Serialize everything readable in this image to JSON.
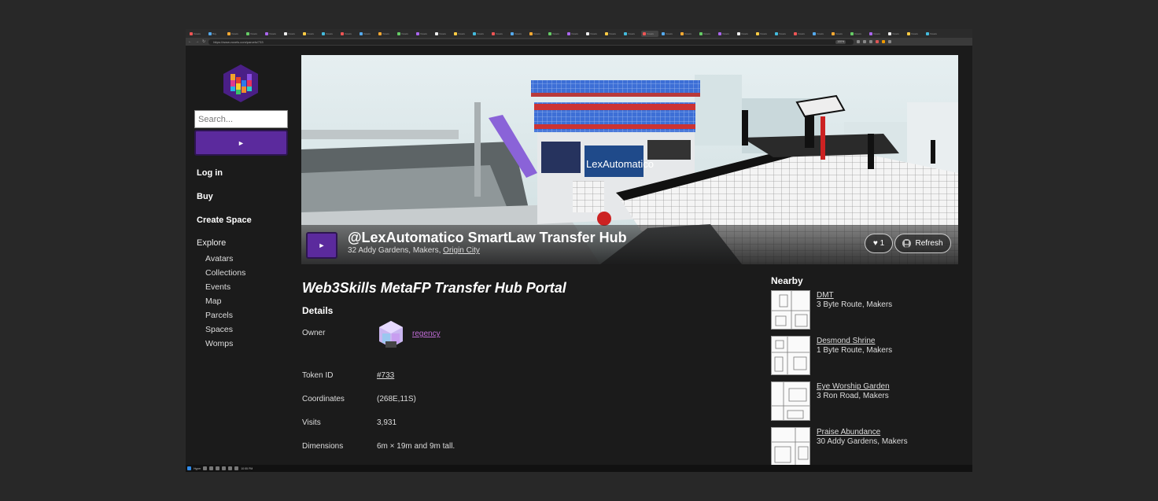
{
  "browser": {
    "tabs": [
      "Voxels",
      "Buy",
      "Voxels",
      "Voxels",
      "Voxels",
      "Voxels",
      "Voxels",
      "Voxels",
      "Voxels",
      "Voxels",
      "Voxels",
      "Voxels",
      "Voxels",
      "Voxels",
      "Voxels",
      "Voxels",
      "Voxels",
      "Voxels",
      "Voxels",
      "Voxels",
      "Voxels",
      "Voxels",
      "Voxels",
      "Voxels",
      "Voxels",
      "Voxels",
      "Voxels",
      "Voxels",
      "Voxels",
      "Voxels",
      "Voxels",
      "Voxels",
      "Voxels",
      "Voxels",
      "Voxels",
      "Voxels",
      "Voxels",
      "Voxels",
      "Voxels",
      "Voxels"
    ],
    "url": "https://www.voxels.com/parcels/733",
    "zoom": "100%"
  },
  "sidebar": {
    "search_placeholder": "Search...",
    "go_label": "►",
    "login": "Log in",
    "buy": "Buy",
    "create_space": "Create Space",
    "explore": "Explore",
    "subnav": [
      "Avatars",
      "Collections",
      "Events",
      "Map",
      "Parcels",
      "Spaces",
      "Womps"
    ]
  },
  "hero": {
    "play_label": "►",
    "title": "@LexAutomatico SmartLaw Transfer Hub",
    "address_prefix": "32 Addy Gardens,  Makers, ",
    "address_link": "Origin City",
    "like_label": "♥ 1",
    "refresh_label": "Refresh",
    "scene_sign": "LexAutomatico"
  },
  "main": {
    "page_title": "Web3Skills MetaFP Transfer Hub Portal",
    "details_heading": "Details",
    "owner_label": "Owner",
    "owner_name": "regency",
    "token_label": "Token ID",
    "token_value": "#733",
    "coords_label": "Coordinates",
    "coords_value": "(268E,11S)",
    "visits_label": "Visits",
    "visits_value": "3,931",
    "dims_label": "Dimensions",
    "dims_value": "6m × 19m and 9m tall."
  },
  "nearby": {
    "heading": "Nearby",
    "items": [
      {
        "name": "DMT",
        "address": "3 Byte Route, Makers"
      },
      {
        "name": "Desmond Shrine",
        "address": "1 Byte Route, Makers"
      },
      {
        "name": "Eye Worship Garden",
        "address": "3 Ron Road, Makers"
      },
      {
        "name": "Praise Abundance",
        "address": "30 Addy Gardens, Makers"
      }
    ]
  },
  "taskbar": {
    "search_text": "Hyper",
    "clock": "10:55 PM"
  },
  "colors": {
    "accent_purple": "#5b2a9d",
    "owner_link": "#c06cd6",
    "page_bg": "#1b1b1b"
  }
}
